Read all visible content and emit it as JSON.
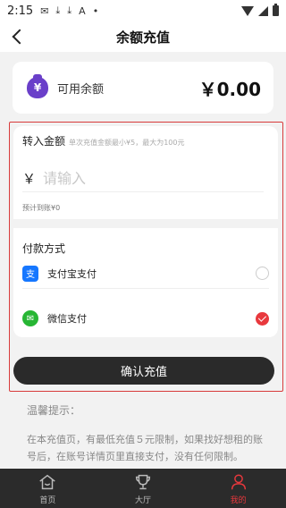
{
  "status_bar": {
    "time": "2:15",
    "icons": [
      "mail-icon",
      "download-icon",
      "download-icon",
      "font-icon",
      "dot-icon",
      "wifi-icon",
      "signal-icon",
      "battery-icon"
    ]
  },
  "nav": {
    "title": "余额充值"
  },
  "balance": {
    "label": "可用余额",
    "amount": "￥0.00"
  },
  "amount_section": {
    "label": "转入金额",
    "hint": "单次充值金额最小¥5，最大为100元",
    "currency_symbol": "￥",
    "input_placeholder": "请输入",
    "input_value": "",
    "expected_label": "预计到账¥0"
  },
  "payment": {
    "label": "付款方式",
    "methods": [
      {
        "name": "支付宝支付",
        "icon": "alipay-icon",
        "icon_glyph": "支",
        "checked": false
      },
      {
        "name": "微信支付",
        "icon": "wechat-icon",
        "icon_glyph": "✉",
        "checked": true
      }
    ]
  },
  "confirm_button": "确认充值",
  "tips": {
    "title": "温馨提示：",
    "line1": "在本充值页，有最低充值５元限制，如果找好想租的账",
    "line2": "号后，在账号详情页里直接支付，没有任何限制。"
  },
  "tabbar": {
    "items": [
      {
        "label": "首页",
        "icon": "home-icon",
        "active": false
      },
      {
        "label": "大厅",
        "icon": "trophy-icon",
        "active": false
      },
      {
        "label": "我的",
        "icon": "user-icon",
        "active": true
      }
    ]
  },
  "colors": {
    "accent": "#e8383d",
    "button": "#2a2a2a",
    "tabbar": "#2b2b2b",
    "wallet": "#6a3fc9"
  }
}
